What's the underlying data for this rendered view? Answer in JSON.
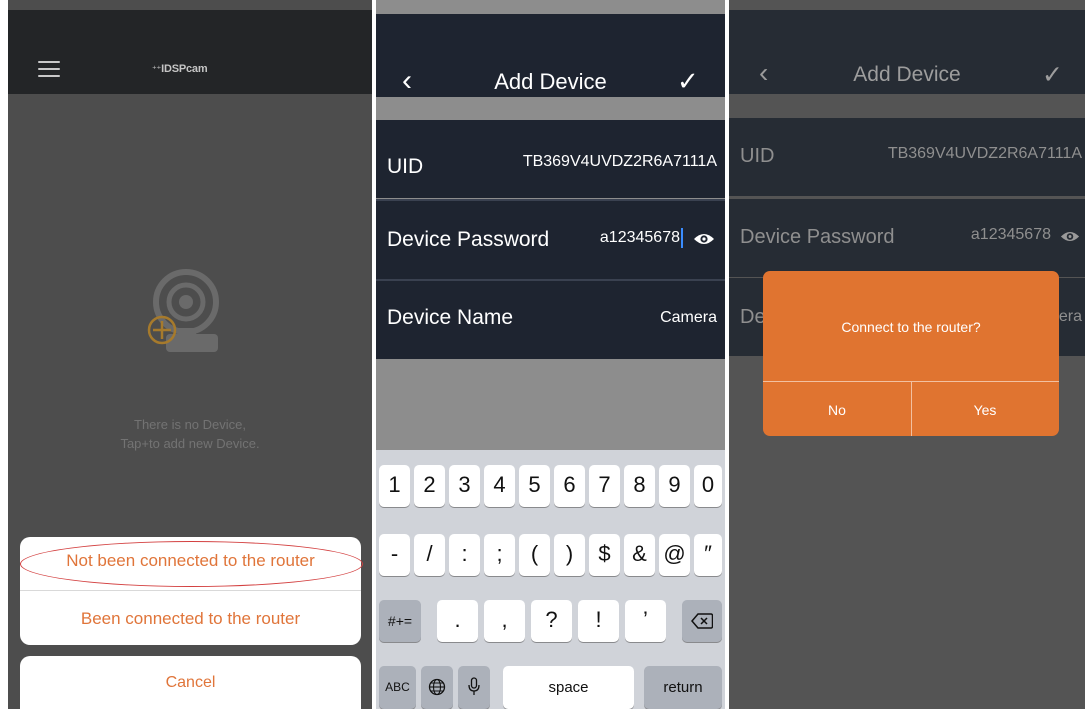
{
  "screen1": {
    "brand": "IDSPcam",
    "empty_line1": "There is no Device,",
    "empty_line2": "Tap+to add new Device.",
    "options": [
      "Not been connected to the router",
      "Been connected to the router"
    ],
    "cancel": "Cancel"
  },
  "screen2": {
    "title": "Add Device",
    "uid_label": "UID",
    "uid_value": "TB369V4UVDZ2R6A7111A",
    "password_label": "Device Password",
    "password_value": "a12345678",
    "name_label": "Device Name",
    "name_value": "Camera",
    "keyboard": {
      "row1": [
        "1",
        "2",
        "3",
        "4",
        "5",
        "6",
        "7",
        "8",
        "9",
        "0"
      ],
      "row2": [
        "-",
        "/",
        ":",
        ";",
        "(",
        ")",
        "$",
        "&",
        "@",
        "″"
      ],
      "row3": [
        "#+=",
        ".",
        ",",
        "?",
        "!",
        "’"
      ],
      "abc": "ABC",
      "space": "space",
      "return": "return"
    }
  },
  "screen3": {
    "title": "Add Device",
    "uid_label": "UID",
    "uid_value": "TB369V4UVDZ2R6A7111A",
    "password_label": "Device Password",
    "password_value": "a12345678",
    "name_label_partial": "De",
    "name_value_partial": "era",
    "dialog_message": "Connect to the router?",
    "dialog_no": "No",
    "dialog_yes": "Yes"
  },
  "colors": {
    "accent": "#e0753a",
    "dialog": "#e07430",
    "dark_header": "#1e2430"
  }
}
